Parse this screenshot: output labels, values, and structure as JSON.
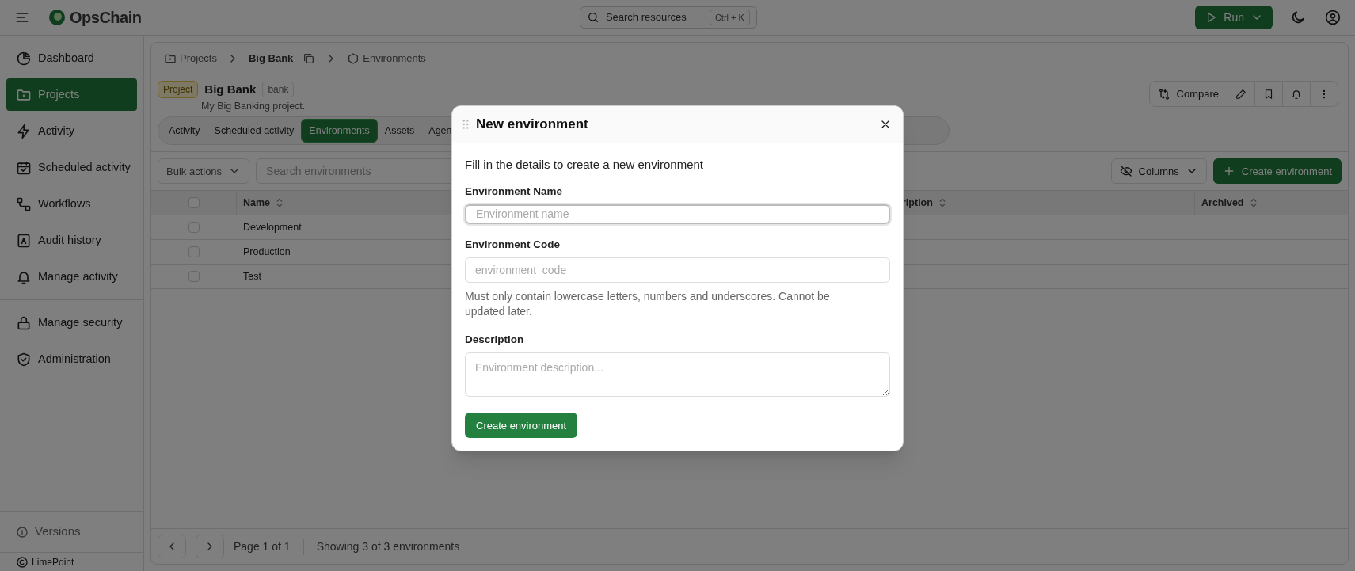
{
  "app": {
    "name": "OpsChain"
  },
  "search": {
    "placeholder": "Search resources",
    "shortcut": "Ctrl + K"
  },
  "run_button": {
    "label": "Run"
  },
  "sidebar": {
    "sections": [
      {
        "items": [
          {
            "label": "Dashboard",
            "selected": false
          },
          {
            "label": "Projects",
            "selected": true
          },
          {
            "label": "Activity",
            "selected": false
          },
          {
            "label": "Scheduled activity",
            "selected": false
          },
          {
            "label": "Workflows",
            "selected": false
          },
          {
            "label": "Audit history",
            "selected": false
          },
          {
            "label": "Manage activity",
            "selected": false
          }
        ]
      },
      {
        "items": [
          {
            "label": "Manage security",
            "selected": false
          },
          {
            "label": "Administration",
            "selected": false
          }
        ]
      }
    ],
    "footer": {
      "versions": "Versions",
      "copyright": "LimePoint"
    }
  },
  "breadcrumbs": [
    {
      "label": "Projects"
    },
    {
      "label": "Big Bank"
    },
    {
      "label": "Environments"
    }
  ],
  "project": {
    "badge": "Project",
    "name": "Big Bank",
    "code": "bank",
    "description": "My Big Banking project."
  },
  "actions": [
    {
      "kind": "compare",
      "label": "Compare"
    },
    {
      "kind": "edit"
    },
    {
      "kind": "bookmark"
    },
    {
      "kind": "notify"
    },
    {
      "kind": "more"
    }
  ],
  "tabs": [
    {
      "label": "Activity",
      "selected": false
    },
    {
      "label": "Scheduled activity",
      "selected": false
    },
    {
      "label": "Environments",
      "selected": true
    },
    {
      "label": "Assets",
      "selected": false
    },
    {
      "label": "Agen",
      "selected": false
    }
  ],
  "toolbar": {
    "bulk_actions": "Bulk actions",
    "search_placeholder": "Search environments",
    "columns": "Columns",
    "create": "Create environment"
  },
  "table": {
    "select_all_checked": false,
    "columns": [
      "Name",
      "ription",
      "Archived"
    ],
    "rows": [
      {
        "name": "Development",
        "checked": false
      },
      {
        "name": "Production",
        "checked": false
      },
      {
        "name": "Test",
        "checked": false
      }
    ]
  },
  "pagination": {
    "page": "Page 1 of 1",
    "summary": "Showing 3 of 3 environments"
  },
  "dialog": {
    "title": "New environment",
    "intro": "Fill in the details to create a new environment",
    "fields": [
      {
        "kind": "input",
        "label": "Environment Name",
        "placeholder": "Environment name",
        "focused": true
      },
      {
        "kind": "input",
        "label": "Environment Code",
        "placeholder": "environment_code",
        "focused": false,
        "help": "Must only contain lowercase letters, numbers and underscores. Cannot be updated later."
      },
      {
        "kind": "textarea",
        "label": "Description",
        "placeholder": "Environment description...",
        "focused": false
      }
    ],
    "submit": "Create environment"
  }
}
